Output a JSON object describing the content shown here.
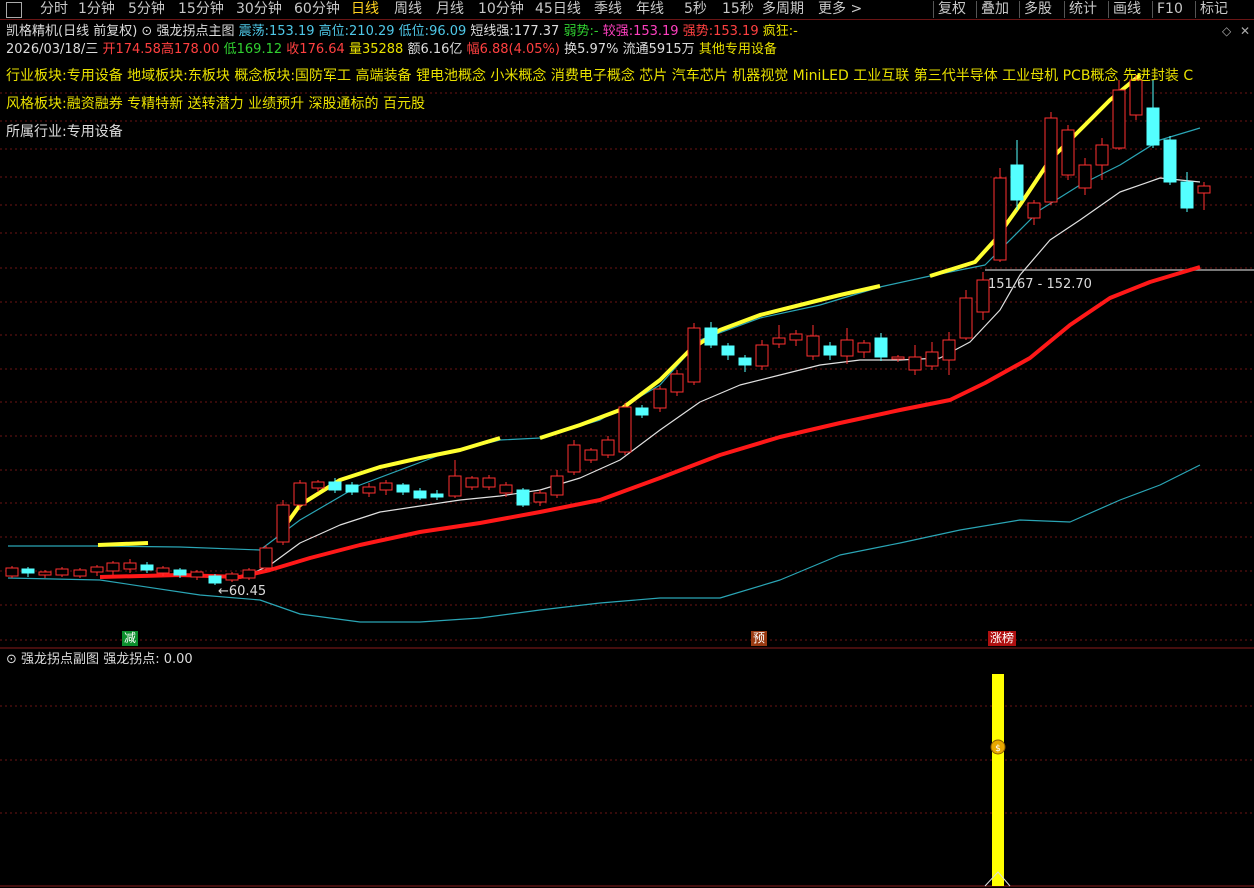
{
  "toolbar": {
    "periods": [
      "分时",
      "1分钟",
      "5分钟",
      "15分钟",
      "30分钟",
      "60分钟",
      "日线",
      "周线",
      "月线",
      "10分钟",
      "45日线",
      "季线",
      "年线",
      "5秒",
      "15秒",
      "多周期",
      "更多 >"
    ],
    "active": "日线",
    "right_buttons": [
      "复权",
      "叠加",
      "多股",
      "统计",
      "画线",
      "F10",
      "标记"
    ]
  },
  "header": {
    "stock": "凯格精机(日线 前复权)",
    "indicator": "强龙拐点主图",
    "zhendang_label": "震荡:",
    "zhendang": "153.19",
    "gaowei_label": "高位:",
    "gaowei": "210.29",
    "diwei_label": "低位:",
    "diwei": "96.09",
    "duanxian_label": "短线强:",
    "duanxian": "177.37",
    "ruoshi_label": "弱势:",
    "ruoshi": "-",
    "jiaoqiang_label": "较强:",
    "jiaoqiang": "153.19",
    "qiangshi_label": "强势:",
    "qiangshi": "153.19",
    "fengkuang_label": "疯狂:",
    "fengkuang": "-"
  },
  "quote": {
    "date": "2026/03/18/三",
    "open_label": "开",
    "open": "174.58",
    "high_label": "高",
    "high": "178.00",
    "low_label": "低",
    "low": "169.12",
    "close_label": "收",
    "close": "176.64",
    "vol_label": "量",
    "vol": "35288",
    "amt_label": "额",
    "amt": "6.16亿",
    "chg_label": "幅",
    "chg": "6.88(4.05%)",
    "turnover_label": "换",
    "turnover": "5.97%",
    "float_label": "流通",
    "float": "5915万",
    "other": "其他专用设备"
  },
  "tags": {
    "line1": "行业板块:专用设备    地域板块:东板块    概念板块:国防军工 高端装备 锂电池概念 小米概念 消费电子概念 芯片 汽车芯片 机器视觉 MiniLED 工业互联 第三代半导体 工业母机 PCB概念 先进封装 C",
    "line2": "风格板块:融资融券 专精特新 送转潜力 业绩预升 深股通标的 百元股",
    "line3": "所属行业:专用设备"
  },
  "annotations": {
    "range_label": "151.67 - 152.70",
    "low_label": "←60.45",
    "marker_jian": "减",
    "marker_yu": "预",
    "marker_zhangbang": "涨榜"
  },
  "sub": {
    "title": "强龙拐点副图",
    "value_label": "强龙拐点:",
    "value": "0.00"
  },
  "colors": {
    "up": "#ff3030",
    "down": "#54ffff",
    "yellow_line": "#ffff30",
    "red_line": "#ff1818",
    "white_line": "#e0e0e0",
    "cyan_band": "#2aa5b5",
    "signal_bar": "#ffff00"
  }
}
